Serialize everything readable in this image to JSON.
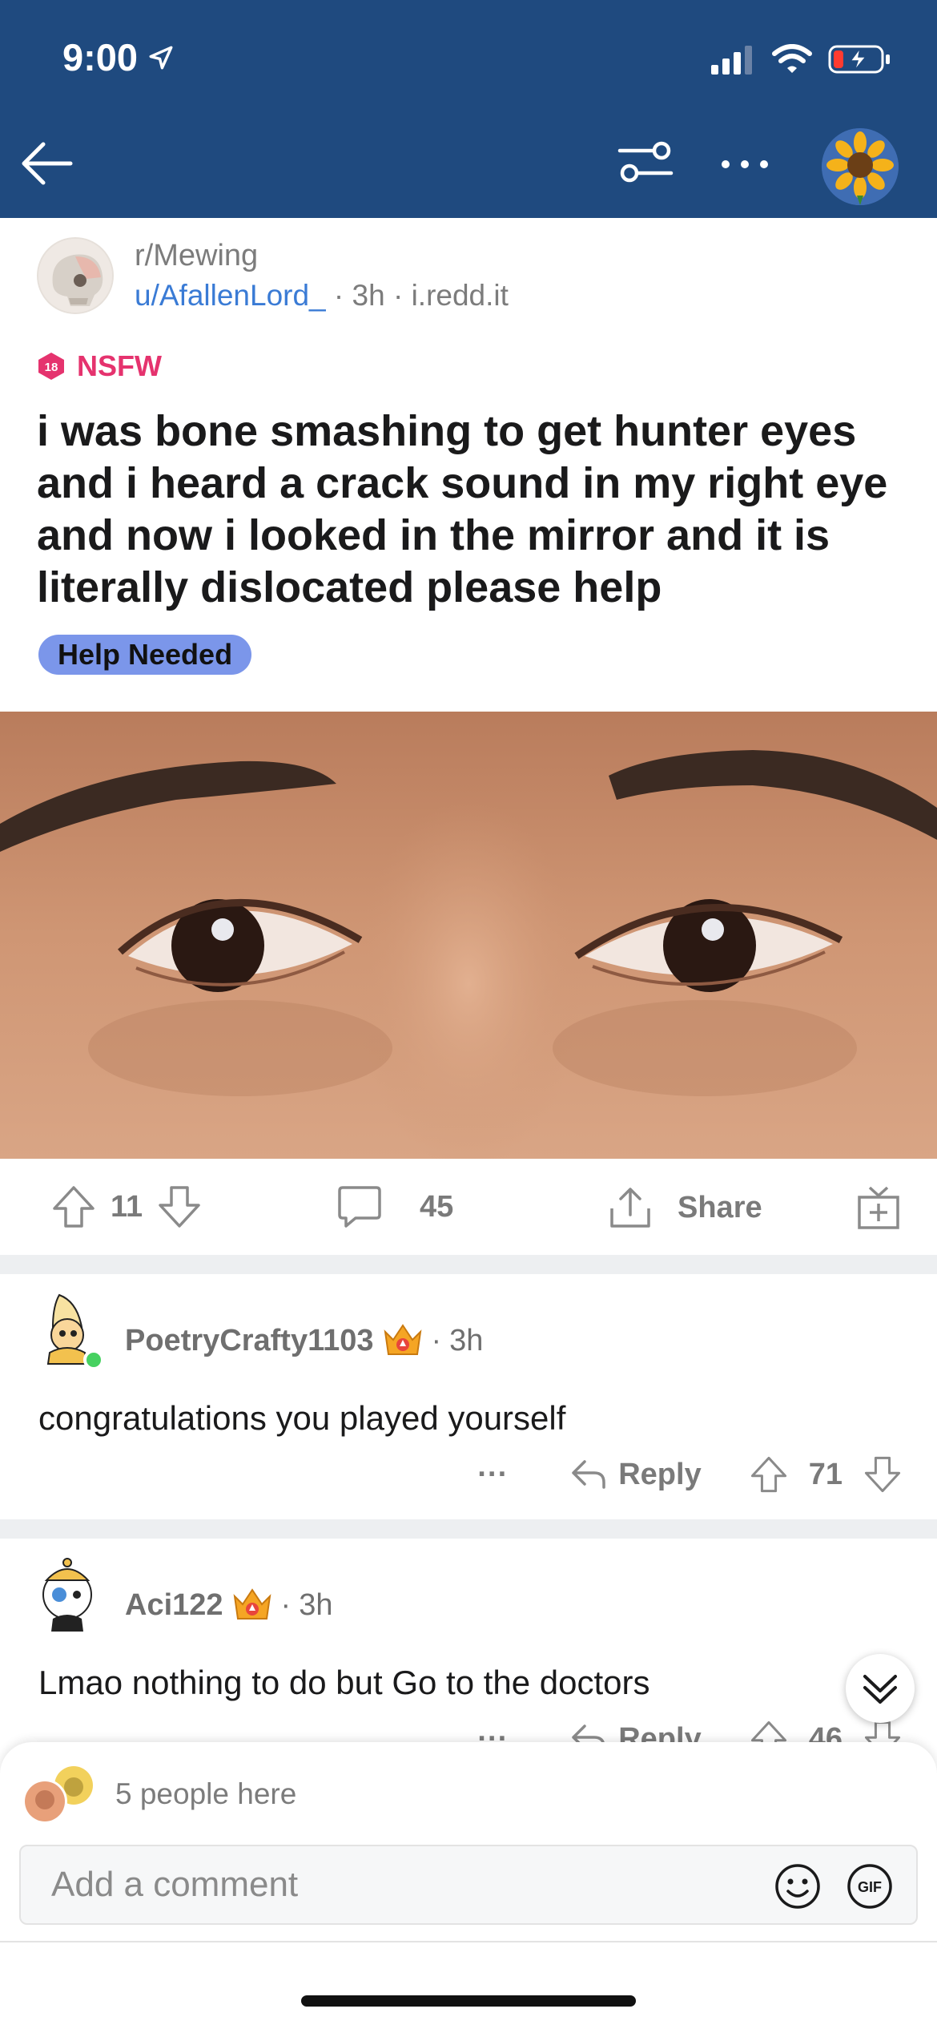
{
  "status_bar": {
    "time": "9:00",
    "battery": "charging"
  },
  "nav": {
    "back_label": "Back",
    "filter_label": "Sort",
    "more_label": "More"
  },
  "post": {
    "subreddit": "r/Mewing",
    "author": "u/AfallenLord_",
    "age": "3h",
    "domain": "i.redd.it",
    "separator": "·",
    "nsfw_label": "NSFW",
    "nsfw_badge": "18",
    "title": "i was bone smashing to get hunter eyes and i heard a crack sound in my right eye and now i looked in the mirror and it is literally dislocated please help",
    "flair": "Help Needed"
  },
  "actions": {
    "score": "11",
    "comments": "45",
    "share_label": "Share"
  },
  "comments": [
    {
      "username": "PoetryCrafty1103",
      "age": "3h",
      "body": "congratulations you played yourself",
      "more": "···",
      "reply_label": "Reply",
      "score": "71",
      "online": true
    },
    {
      "username": "Aci122",
      "age": "3h",
      "body": "Lmao nothing to do but Go to the doctors",
      "more": "···",
      "reply_label": "Reply",
      "score": "46",
      "online": false
    }
  ],
  "composer": {
    "presence": "5 people here",
    "placeholder": "Add a comment",
    "gif_label": "GIF"
  },
  "colors": {
    "header_bg": "#1f4a7f",
    "nsfw": "#e5336e",
    "flair_bg": "#7b96ea",
    "link": "#3a7bd5",
    "online": "#46d160"
  },
  "icons": [
    "back-arrow-icon",
    "filter-icon",
    "more-icon",
    "sunflower-avatar",
    "upvote-icon",
    "downvote-icon",
    "comment-icon",
    "share-icon",
    "award-icon",
    "reply-icon",
    "chevron-down-icon",
    "emoji-icon",
    "gif-icon"
  ]
}
